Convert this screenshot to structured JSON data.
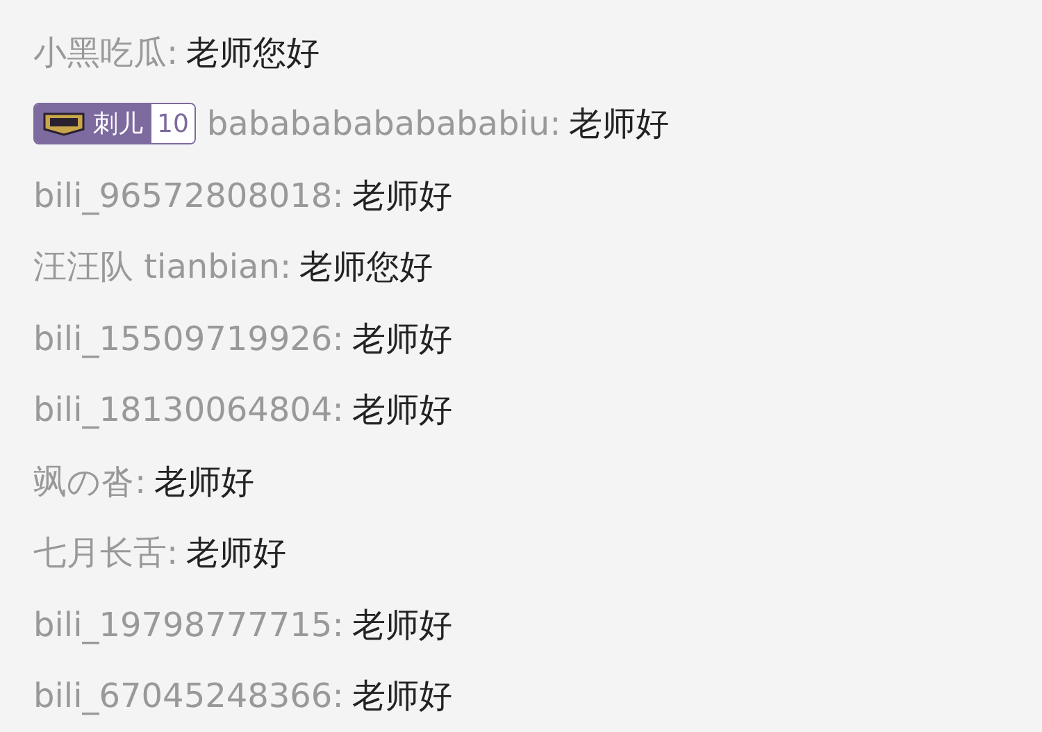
{
  "messages": [
    {
      "user": "小黑吃瓜:",
      "text": "老师您好"
    },
    {
      "user": "babababababababiu:",
      "text": "老师好",
      "medal": {
        "name": "刺儿",
        "level": "10"
      }
    },
    {
      "user": "bili_96572808018:",
      "text": "老师好"
    },
    {
      "user": "汪汪队 tianbian:",
      "text": "老师您好"
    },
    {
      "user": "bili_15509719926:",
      "text": "老师好"
    },
    {
      "user": "bili_18130064804:",
      "text": "老师好"
    },
    {
      "user": "飒の沓:",
      "text": "老师好"
    },
    {
      "user": "七月长舌:",
      "text": "老师好"
    },
    {
      "user": "bili_19798777715:",
      "text": "老师好"
    },
    {
      "user": "bili_67045248366:",
      "text": "老师好"
    }
  ]
}
